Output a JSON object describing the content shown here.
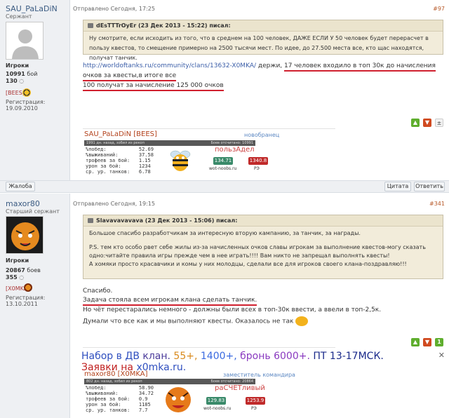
{
  "post1": {
    "username": "SAU_PaLaDiN",
    "rank": "Сержант",
    "group": "Игроки",
    "battles_value": "10991",
    "battles_label": "бой",
    "rep_value": "130",
    "clan_tag": "[BEES]",
    "reg_label": "Регистрация:",
    "reg_date": "19.09.2010",
    "posted": "Отправлено Сегодня, 17:25",
    "post_number": "#97",
    "quote_author": "dEsTTTrOyEr (23 Дек 2013 - 15:22) писал:",
    "quote_text": "Ну смотрите, если исходить из того, что в среднем на 100 человек, ДАЖЕ ЕСЛИ У 50 человек будет перерасчет в пользу квестов, то смещение примерно на 2500 тысячи мест. По идее, до 27.500 места все, кто щас находятся, получат танчик.",
    "link_text": "http://worldoftanks.ru/community/clans/13632-X0MKA/",
    "text_after_link": " держи,",
    "underlined_part1": "17 человек входило в топ 30к до начисления очков за квесты,в итоге все",
    "underlined_part2": "100 получат за начисление 125 000 очков",
    "sig": {
      "name": "SAU_PaLaDiN [BEES]",
      "role": "новобранец",
      "bar_left": "1991 дн. назад, зобил из рекоп",
      "bar_right": "Боев отсчитано: 10991",
      "rows": [
        "%побед:           52.69",
        "%выживаний:       37.58",
        "трофеев за бой:   1.15",
        "урон за бой:      1234",
        "ср. ур. танков:   6.78"
      ],
      "nick": "пользАдел",
      "wn_value": "134.71",
      "wn_site": "wot-noobs.ru",
      "re_value": "1340.8",
      "re_label": "РЭ"
    }
  },
  "buttons": {
    "complain": "Жалоба",
    "quote": "Цитата",
    "reply": "Ответить"
  },
  "post2": {
    "username": "maxor80",
    "rank": "Старший сержант",
    "group": "Игроки",
    "battles_value": "20867",
    "battles_label": "боев",
    "rep_value": "355",
    "clan_tag": "[X0MKA]",
    "reg_label": "Регистрация:",
    "reg_date": "13.10.2011",
    "posted": "Отправлено Сегодня, 19:15",
    "post_number": "#341",
    "quote_author": "Slavavavavava (23 Дек 2013 - 15:06) писал:",
    "quote_p1": "Большое спасибо разработчикам за интересную вторую кампанию, за танчик, за награды.",
    "quote_p2": "P.S. тем кто особо рвет себе жилы из-за начисленных очков славы игрокам за выполнение квестов-могу сказать одно:читайте правила игры прежде чем в нее играть!!!! Вам никто не запрещал выполнять квесты!",
    "quote_p3": "А хомяки просто красавчики и комы у них молодцы, сделали все для игроков своего клана-поздравляю!!!",
    "line1": "Спасибо.",
    "line2": "Задача стояла всем игрокам клана сделать танчик.",
    "line3": "Но чёт перестарались немного - должны были всех в топ-30к ввести, а ввели в топ-2,5к.",
    "line4": "Думали что все как и мы выполняют квесты. Оказалось не так",
    "vote_count": "1",
    "banner": {
      "w1": "Набор",
      "w2": "в",
      "w3": "ДВ",
      "w4": "клан.",
      "w5": "55+,",
      "w6": "1400+,",
      "w7": "бронь",
      "w8": "6000+.",
      "w9": "ПТ",
      "w10": "13-17МСК.",
      "w11": "Заявки",
      "w12": "на",
      "w13": "x0mka.ru."
    },
    "sig": {
      "name": "maxor80 [X0MKA]",
      "role": "заместитель командира",
      "bar_left": "802 дн. назад, зобил из рекоп",
      "bar_right": "Боев отсчитано: 20864",
      "rows": [
        "%побед:           58.90",
        "%выживаний:       34.72",
        "трофеев за бой:   0.9",
        "урон за бой:      1185",
        "ср. ур. танков:   7.7"
      ],
      "nick": "раСЧЕТливый",
      "wn_value": "129.83",
      "wn_site": "wot-noobs.ru",
      "re_value": "1253.9",
      "re_label": "РЭ"
    }
  },
  "colors": {
    "link": "#3b5ea8",
    "accent_red": "#d0202e",
    "username": "#3b5b82",
    "sidebar_bg": "#eef0f3",
    "quote_bg": "#f2ecda"
  }
}
